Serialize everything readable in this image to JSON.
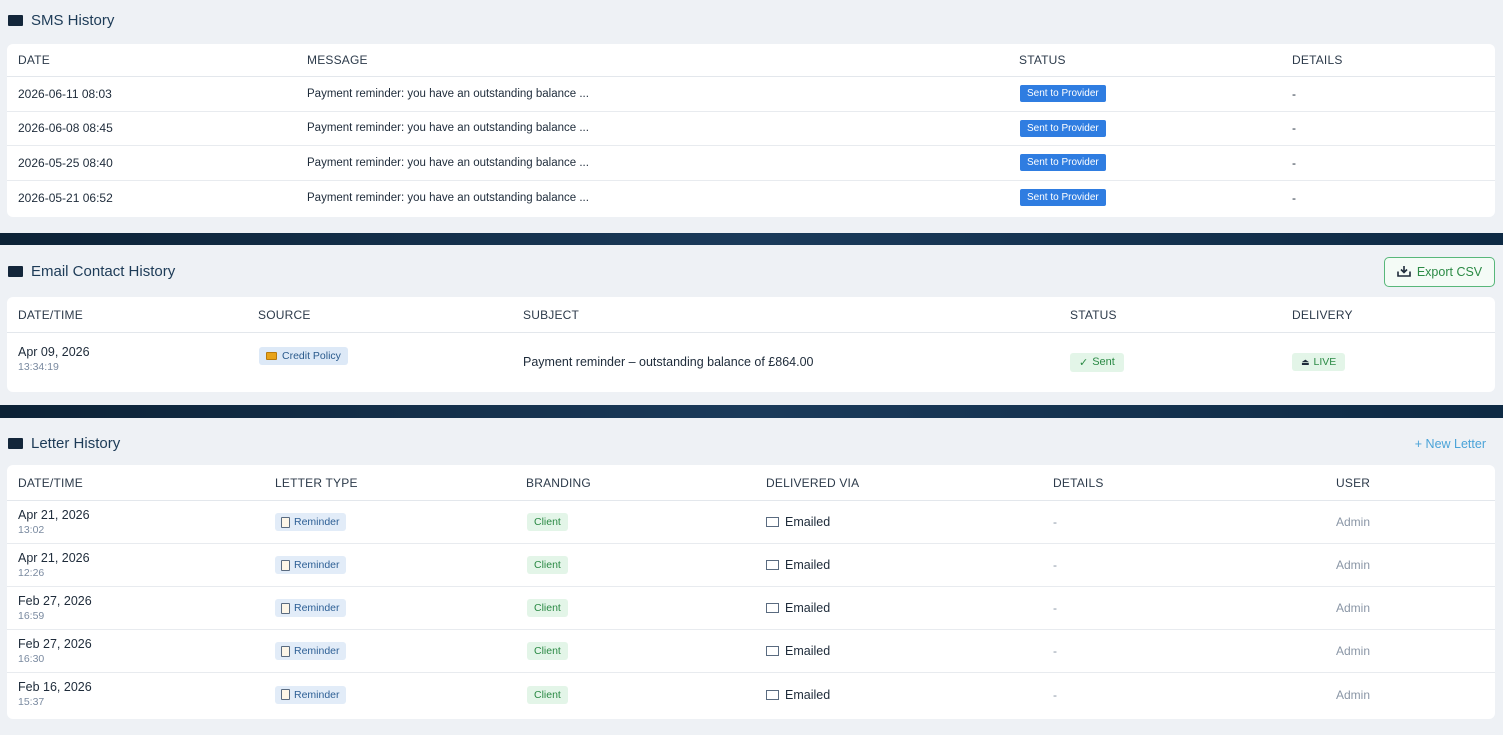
{
  "sms": {
    "title": "SMS History",
    "headers": {
      "date": "DATE",
      "message": "MESSAGE",
      "status": "STATUS",
      "details": "DETAILS"
    },
    "rows": [
      {
        "date": "2026-06-11 08:03",
        "message": "Payment reminder: you have an outstanding balance ...",
        "status": "Sent to Provider",
        "details": "-"
      },
      {
        "date": "2026-06-08 08:45",
        "message": "Payment reminder: you have an outstanding balance ...",
        "status": "Sent to Provider",
        "details": "-"
      },
      {
        "date": "2026-05-25 08:40",
        "message": "Payment reminder: you have an outstanding balance ...",
        "status": "Sent to Provider",
        "details": "-"
      },
      {
        "date": "2026-05-21 06:52",
        "message": "Payment reminder: you have an outstanding balance ...",
        "status": "Sent to Provider",
        "details": "-"
      }
    ]
  },
  "email": {
    "title": "Email Contact History",
    "export_label": "Export CSV",
    "headers": {
      "datetime": "DATE/TIME",
      "source": "SOURCE",
      "subject": "SUBJECT",
      "status": "STATUS",
      "delivery": "DELIVERY"
    },
    "rows": [
      {
        "date": "Apr 09, 2026",
        "time": "13:34:19",
        "source": "Credit Policy",
        "subject": "Payment reminder – outstanding balance of £864.00",
        "status": "Sent",
        "delivery": "LIVE"
      }
    ]
  },
  "letter": {
    "title": "Letter History",
    "new_label": "+ New Letter",
    "headers": {
      "datetime": "DATE/TIME",
      "type": "LETTER TYPE",
      "branding": "BRANDING",
      "via": "DELIVERED VIA",
      "details": "DETAILS",
      "user": "USER"
    },
    "rows": [
      {
        "date": "Apr 21, 2026",
        "time": "13:02",
        "type": "Reminder",
        "branding": "Client",
        "via": "Emailed",
        "details": "-",
        "user": "Admin"
      },
      {
        "date": "Apr 21, 2026",
        "time": "12:26",
        "type": "Reminder",
        "branding": "Client",
        "via": "Emailed",
        "details": "-",
        "user": "Admin"
      },
      {
        "date": "Feb 27, 2026",
        "time": "16:59",
        "type": "Reminder",
        "branding": "Client",
        "via": "Emailed",
        "details": "-",
        "user": "Admin"
      },
      {
        "date": "Feb 27, 2026",
        "time": "16:30",
        "type": "Reminder",
        "branding": "Client",
        "via": "Emailed",
        "details": "-",
        "user": "Admin"
      },
      {
        "date": "Feb 16, 2026",
        "time": "15:37",
        "type": "Reminder",
        "branding": "Client",
        "via": "Emailed",
        "details": "-",
        "user": "Admin"
      }
    ]
  },
  "colors": {
    "accent_blue": "#2f7de1",
    "success_green": "#2b8a45",
    "link_blue": "#4aa3d8",
    "page_dark": "#0f2740"
  }
}
